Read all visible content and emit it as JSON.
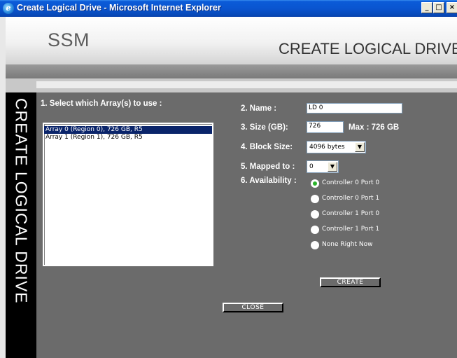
{
  "window": {
    "title": "Create Logical Drive - Microsoft Internet Explorer",
    "minimize": "_",
    "maximize": "□",
    "close": "×"
  },
  "header": {
    "logo": "SSM",
    "heading": "CREATE LOGICAL DRIVE"
  },
  "side_label": "CREATE LOGICAL DRIVE",
  "form": {
    "select_arrays_label": "1. Select which Array(s) to use :",
    "arrays": [
      {
        "label": "Array 0 (Region 0), 726 GB, R5",
        "selected": true
      },
      {
        "label": "Array 1 (Region 1), 726 GB, R5",
        "selected": false
      }
    ],
    "name_label": "2. Name :",
    "name_value": "LD 0",
    "size_label": "3. Size (GB):",
    "size_value": "726",
    "size_max": "Max : 726 GB",
    "block_size_label": "4. Block Size:",
    "block_size_value": "4096 bytes",
    "mapped_to_label": "5. Mapped to :",
    "mapped_to_value": "0",
    "availability_label": "6. Availability :",
    "availability_options": [
      {
        "label": "Controller 0 Port 0",
        "checked": true
      },
      {
        "label": "Controller 0 Port 1",
        "checked": false
      },
      {
        "label": "Controller 1 Port 0",
        "checked": false
      },
      {
        "label": "Controller 1 Port 1",
        "checked": false
      },
      {
        "label": "None Right Now",
        "checked": false
      }
    ],
    "create_button": "CREATE",
    "close_button": "CLOSE"
  }
}
